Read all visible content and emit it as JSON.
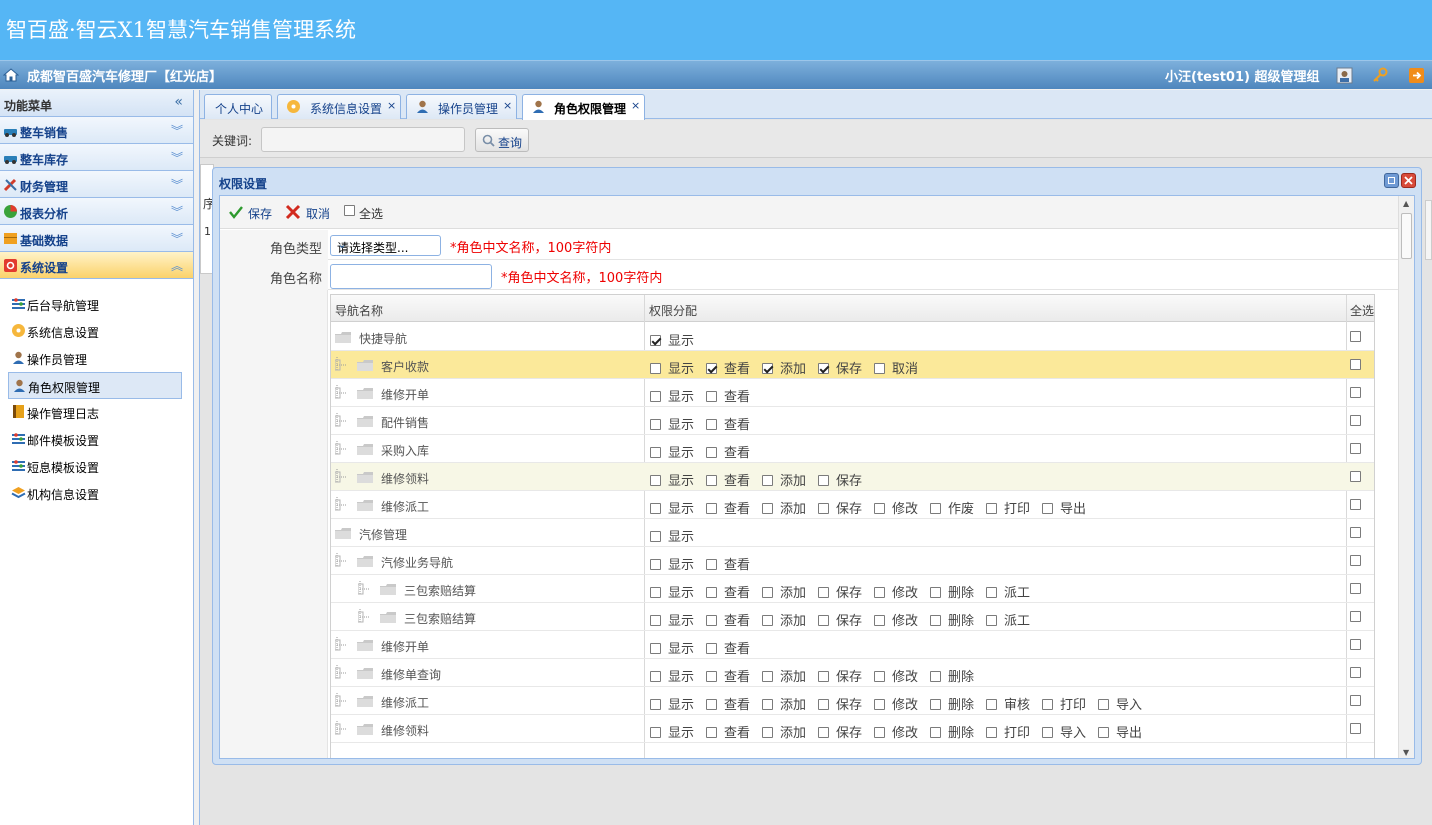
{
  "app": {
    "title": "智百盛·智云X1智慧汽车销售管理系统",
    "shop": "成都智百盛汽车修理厂【红光店】",
    "user": "小汪(test01) 超级管理组"
  },
  "sidebar": {
    "header": "功能菜单",
    "sections": [
      {
        "label": "整车销售"
      },
      {
        "label": "整车库存"
      },
      {
        "label": "财务管理"
      },
      {
        "label": "报表分析"
      },
      {
        "label": "基础数据"
      },
      {
        "label": "系统设置"
      }
    ],
    "items": [
      {
        "label": "后台导航管理"
      },
      {
        "label": "系统信息设置"
      },
      {
        "label": "操作员管理"
      },
      {
        "label": "角色权限管理"
      },
      {
        "label": "操作管理日志"
      },
      {
        "label": "邮件模板设置"
      },
      {
        "label": "短息模板设置"
      },
      {
        "label": "机构信息设置"
      }
    ]
  },
  "tabs": [
    {
      "label": "个人中心"
    },
    {
      "label": "系统信息设置"
    },
    {
      "label": "操作员管理"
    },
    {
      "label": "角色权限管理"
    }
  ],
  "tab_close": "×",
  "search": {
    "label": "关键词:",
    "button": "查询"
  },
  "bg": {
    "c1": "序",
    "c2": "1"
  },
  "modal": {
    "title": "权限设置",
    "save": "保存",
    "cancel": "取消",
    "select_all": "全选",
    "role_type_label": "角色类型",
    "role_type_value": "请选择类型...",
    "role_name_label": "角色名称",
    "hint": "*角色中文名称，100字符内",
    "grid_headers": {
      "name": "导航名称",
      "perms": "权限分配",
      "all": "全选"
    },
    "rows": [
      {
        "name": "快捷导航",
        "level": 0,
        "perms": [
          {
            "label": "显示",
            "checked": true
          }
        ]
      },
      {
        "name": "客户收款",
        "level": 1,
        "highlight": "sel1",
        "perms": [
          {
            "label": "显示",
            "checked": false
          },
          {
            "label": "查看",
            "checked": true
          },
          {
            "label": "添加",
            "checked": true
          },
          {
            "label": "保存",
            "checked": true
          },
          {
            "label": "取消",
            "checked": false
          }
        ]
      },
      {
        "name": "维修开单",
        "level": 1,
        "perms": [
          {
            "label": "显示"
          },
          {
            "label": "查看"
          }
        ]
      },
      {
        "name": "配件销售",
        "level": 1,
        "perms": [
          {
            "label": "显示"
          },
          {
            "label": "查看"
          }
        ]
      },
      {
        "name": "采购入库",
        "level": 1,
        "perms": [
          {
            "label": "显示"
          },
          {
            "label": "查看"
          }
        ]
      },
      {
        "name": "维修领料",
        "level": 1,
        "highlight": "sel2",
        "perms": [
          {
            "label": "显示"
          },
          {
            "label": "查看"
          },
          {
            "label": "添加"
          },
          {
            "label": "保存"
          }
        ]
      },
      {
        "name": "维修派工",
        "level": 1,
        "perms": [
          {
            "label": "显示"
          },
          {
            "label": "查看"
          },
          {
            "label": "添加"
          },
          {
            "label": "保存"
          },
          {
            "label": "修改"
          },
          {
            "label": "作废"
          },
          {
            "label": "打印"
          },
          {
            "label": "导出"
          }
        ]
      },
      {
        "name": "汽修管理",
        "level": 0,
        "perms": [
          {
            "label": "显示"
          }
        ]
      },
      {
        "name": "汽修业务导航",
        "level": 1,
        "perms": [
          {
            "label": "显示"
          },
          {
            "label": "查看"
          }
        ]
      },
      {
        "name": "三包索赔结算",
        "level": 2,
        "perms": [
          {
            "label": "显示"
          },
          {
            "label": "查看"
          },
          {
            "label": "添加"
          },
          {
            "label": "保存"
          },
          {
            "label": "修改"
          },
          {
            "label": "删除"
          },
          {
            "label": "派工"
          }
        ]
      },
      {
        "name": "三包索赔结算",
        "level": 2,
        "perms": [
          {
            "label": "显示"
          },
          {
            "label": "查看"
          },
          {
            "label": "添加"
          },
          {
            "label": "保存"
          },
          {
            "label": "修改"
          },
          {
            "label": "删除"
          },
          {
            "label": "派工"
          }
        ]
      },
      {
        "name": "维修开单",
        "level": 1,
        "perms": [
          {
            "label": "显示"
          },
          {
            "label": "查看"
          }
        ]
      },
      {
        "name": "维修单查询",
        "level": 1,
        "perms": [
          {
            "label": "显示"
          },
          {
            "label": "查看"
          },
          {
            "label": "添加"
          },
          {
            "label": "保存"
          },
          {
            "label": "修改"
          },
          {
            "label": "删除"
          }
        ]
      },
      {
        "name": "维修派工",
        "level": 1,
        "perms": [
          {
            "label": "显示"
          },
          {
            "label": "查看"
          },
          {
            "label": "添加"
          },
          {
            "label": "保存"
          },
          {
            "label": "修改"
          },
          {
            "label": "删除"
          },
          {
            "label": "审核"
          },
          {
            "label": "打印"
          },
          {
            "label": "导入"
          }
        ]
      },
      {
        "name": "维修领料",
        "level": 1,
        "perms": [
          {
            "label": "显示"
          },
          {
            "label": "查看"
          },
          {
            "label": "添加"
          },
          {
            "label": "保存"
          },
          {
            "label": "修改"
          },
          {
            "label": "删除"
          },
          {
            "label": "打印"
          },
          {
            "label": "导入"
          },
          {
            "label": "导出"
          }
        ]
      }
    ]
  }
}
